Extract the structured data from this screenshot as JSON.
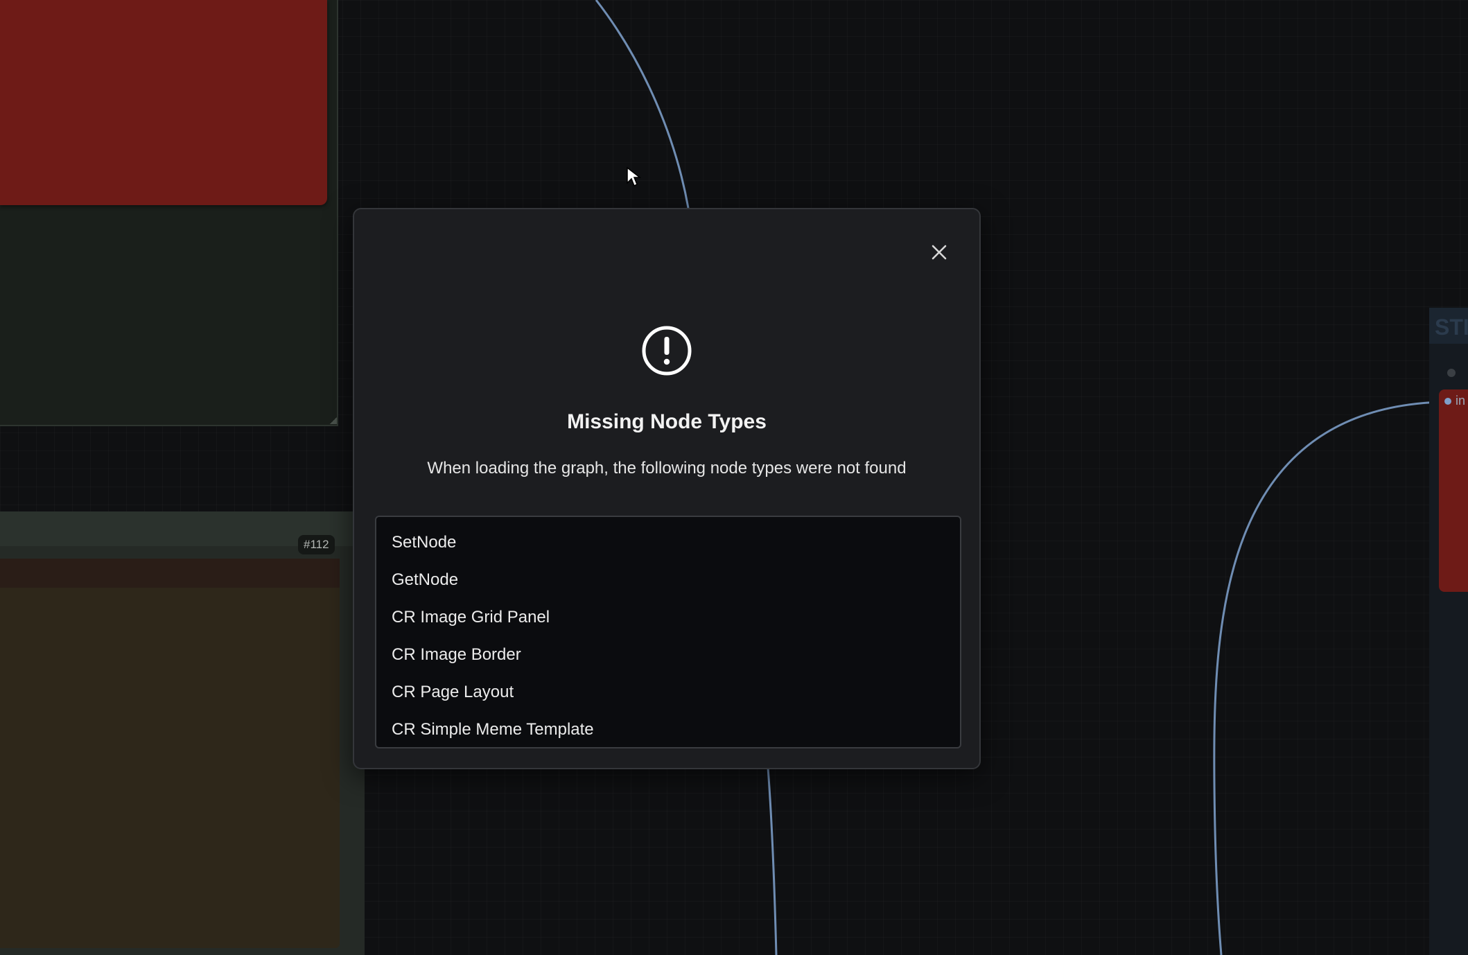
{
  "canvas": {
    "left_node_badge": "#112",
    "right_node_title": "STI",
    "right_node_input_label": "in"
  },
  "dialog": {
    "title": "Missing Node Types",
    "message": "When loading the graph, the following node types were not found",
    "close_icon": "close-icon",
    "alert_icon": "alert-circle-icon",
    "missing_types": [
      "SetNode",
      "GetNode",
      "CR Image Grid Panel",
      "CR Image Border",
      "CR Page Layout",
      "CR Simple Meme Template"
    ]
  },
  "colors": {
    "background": "#0f1012",
    "dialog_bg": "#1c1d20",
    "list_bg": "#0b0c0f",
    "wire": "#7fa0c9",
    "node_red": "#6e1b17"
  }
}
